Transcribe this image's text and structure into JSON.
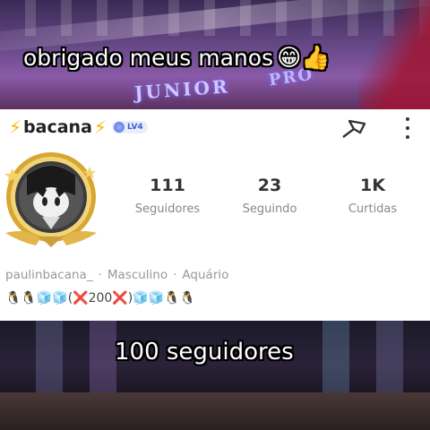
{
  "overlay": {
    "top_caption": "obrigado meus manos",
    "top_caption_emojis": "😁👍",
    "bottom_caption": "100 seguidores",
    "background_sign_1": "JUNIOR",
    "background_sign_2": "PRO"
  },
  "profile": {
    "bolt_left": "⚡",
    "name": "bacana",
    "bolt_right": "⚡",
    "level_badge": "LV4",
    "stats": [
      {
        "value": "111",
        "label": "Seguidores"
      },
      {
        "value": "23",
        "label": "Seguindo"
      },
      {
        "value": "1K",
        "label": "Curtidas"
      }
    ],
    "username": "paulinbacana_",
    "gender": "Masculino",
    "sign": "Aquário",
    "separator": "·",
    "bio": "🐧🐧🧊🧊(❌200❌)🧊🧊🐧🐧"
  },
  "icons": {
    "share": "share-arrow-icon",
    "more": "more-vertical-icon"
  },
  "colors": {
    "bolt": "#f7b800",
    "level": "#3b5fd0",
    "avatar_gold": "#d8a631"
  }
}
